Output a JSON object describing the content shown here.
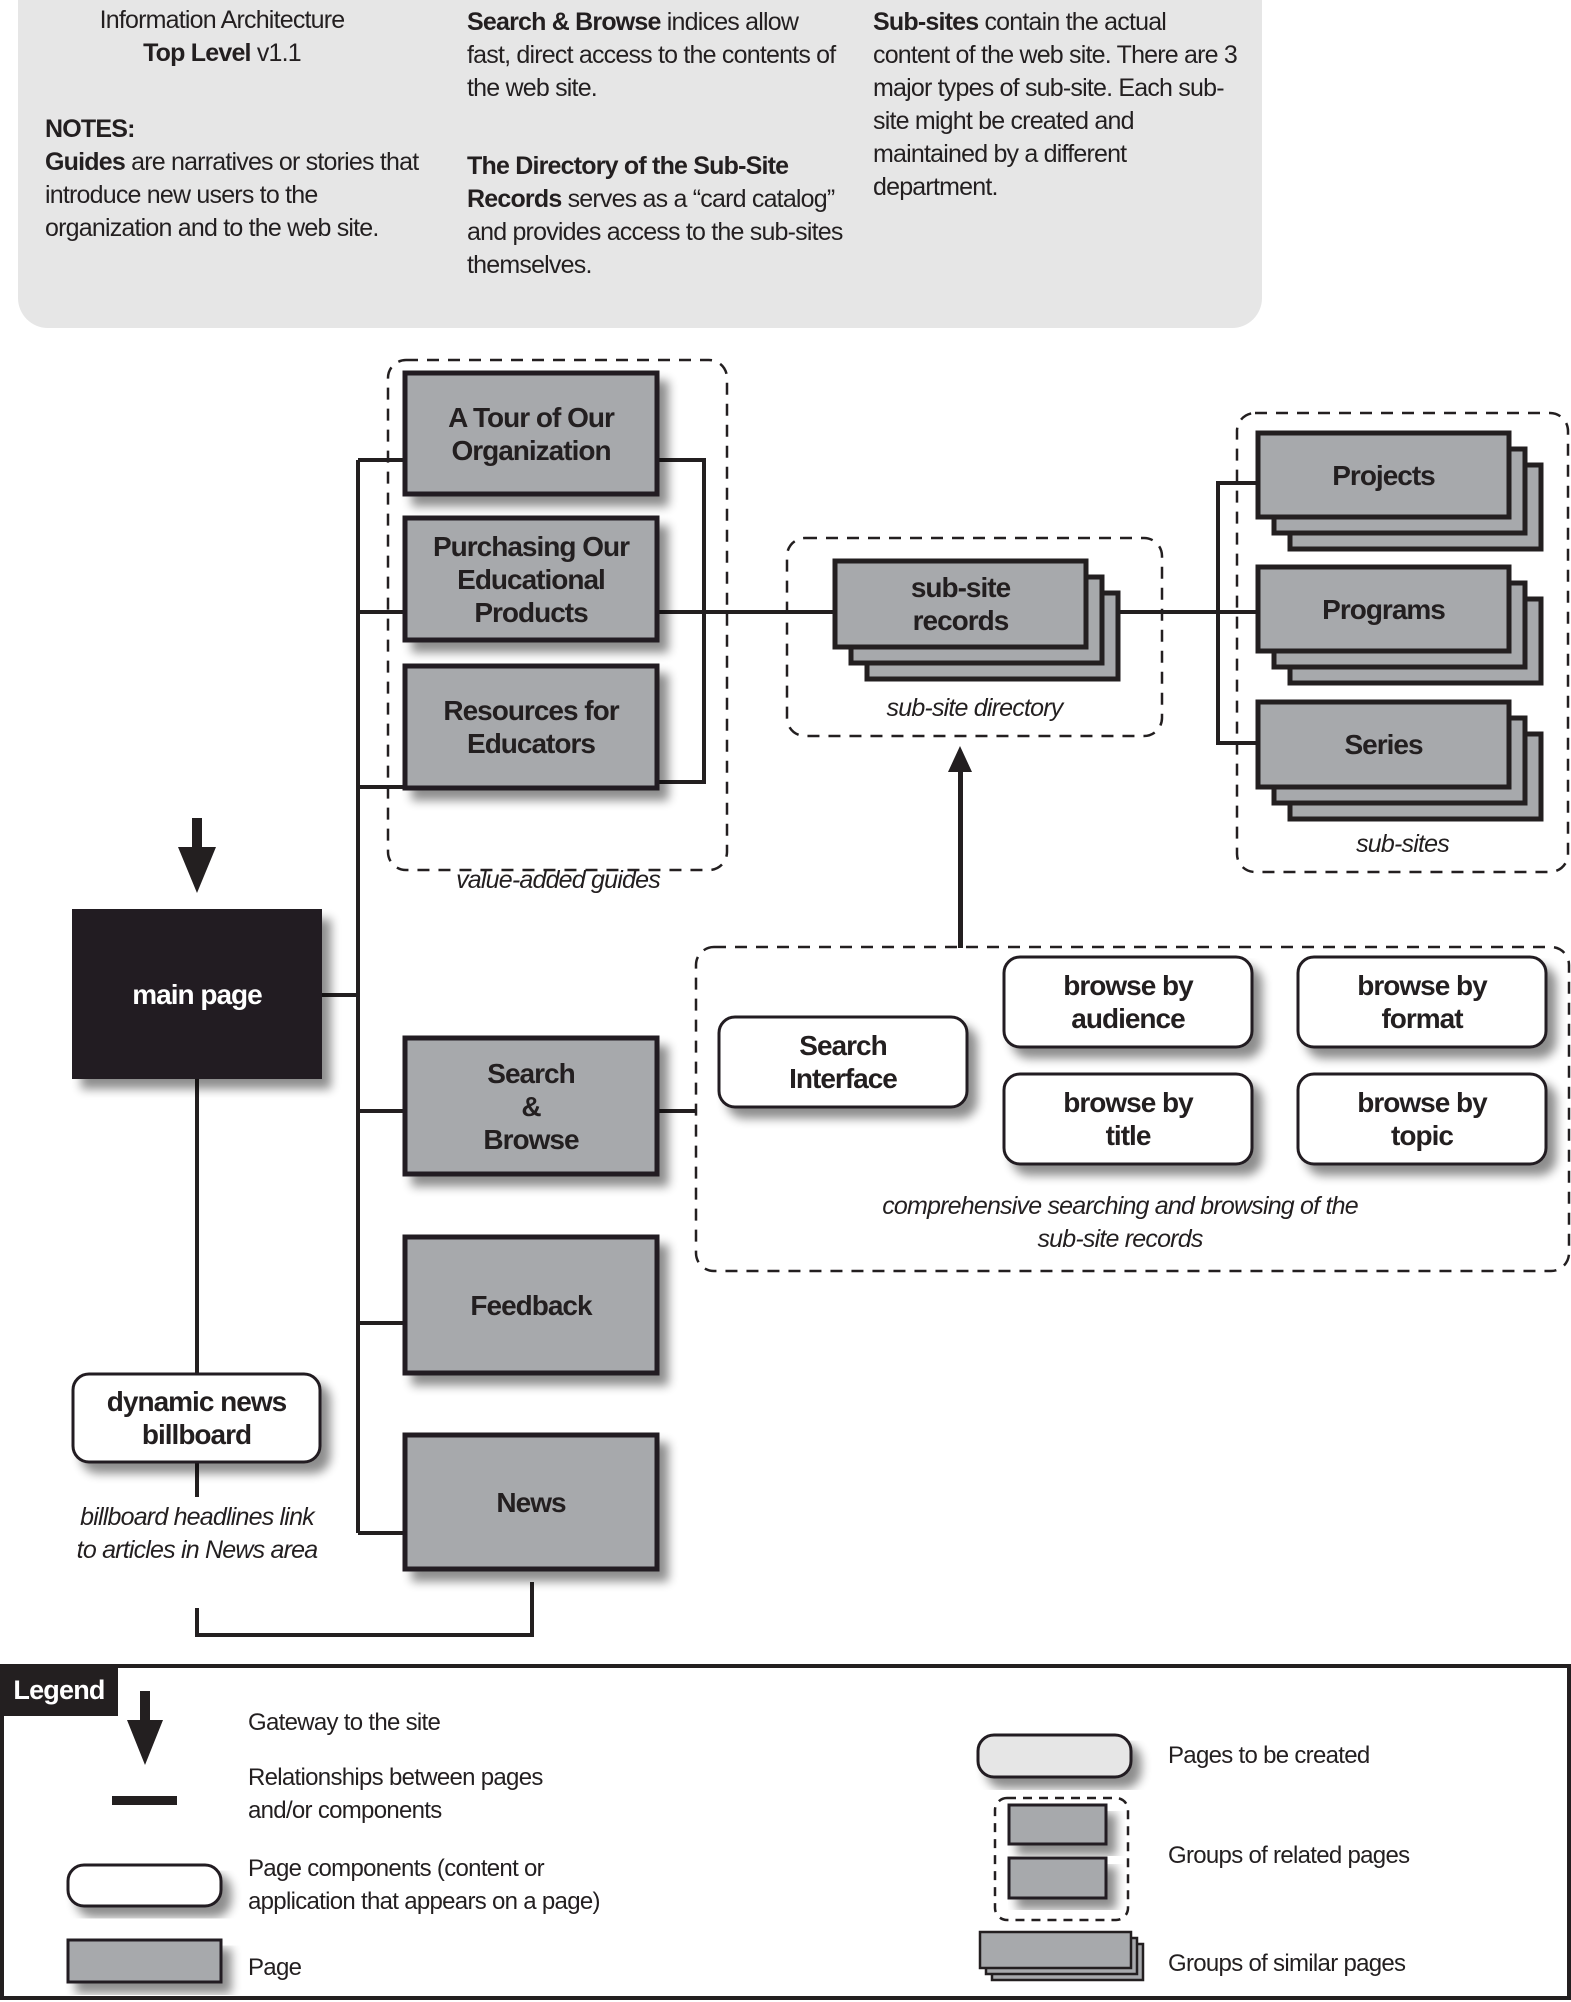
{
  "notes": {
    "title_line1": "Information Architecture",
    "title_bold": "Top Level",
    "title_version": "v1.1",
    "notes_heading": "NOTES:",
    "guides_bold": "Guides",
    "guides_text": " are narratives or stories that introduce new users to the organization and to the web site.",
    "search_bold": "Search & Browse",
    "search_text": " indices allow fast, direct access to the contents of the web site.",
    "directory_bold": "The Directory of the Sub-Site Records",
    "directory_text": " serves as a “card catalog” and provides access to the sub-sites themselves.",
    "subsites_bold": "Sub-sites",
    "subsites_text": " contain the actual content of the web site. There are 3 major types of sub-site. Each sub-site might be created and maintained by a different department."
  },
  "diagram": {
    "main_page": "main page",
    "guides": [
      "A Tour of Our Organization",
      "Purchasing Our Educational Products",
      "Resources for Educators"
    ],
    "guides_caption": "value-added guides",
    "sub_site_records": "sub-site records",
    "sub_site_directory_caption": "sub-site directory",
    "sub_sites": [
      "Projects",
      "Programs",
      "Series"
    ],
    "sub_sites_caption": "sub-sites",
    "search_browse": "Search & Browse",
    "feedback": "Feedback",
    "news": "News",
    "search_interface": "Search Interface",
    "browse_components": [
      "browse by audience",
      "browse by format",
      "browse by title",
      "browse by topic"
    ],
    "search_caption": "comprehensive searching and browsing of the sub-site records",
    "billboard": "dynamic news billboard",
    "billboard_caption": "billboard headlines link to articles in News area"
  },
  "legend": {
    "title": "Legend",
    "items": [
      {
        "icon": "gateway-arrow-icon",
        "label": "Gateway to the site"
      },
      {
        "icon": "relationship-line-icon",
        "label": "Relationships between pages and/or components"
      },
      {
        "icon": "page-component-icon",
        "label": "Page components (content or application that appears on a page)"
      },
      {
        "icon": "page-icon",
        "label": "Page"
      },
      {
        "icon": "page-to-be-created-icon",
        "label": "Pages to be created"
      },
      {
        "icon": "related-pages-group-icon",
        "label": "Groups of related pages"
      },
      {
        "icon": "similar-pages-group-icon",
        "label": "Groups of similar pages"
      }
    ]
  },
  "colors": {
    "ink": "#231f20",
    "page_fill": "#a7a9ac",
    "notes_bg": "#e6e6e6",
    "to_be_created_fill": "#e6e6e6",
    "component_fill": "#ffffff"
  }
}
